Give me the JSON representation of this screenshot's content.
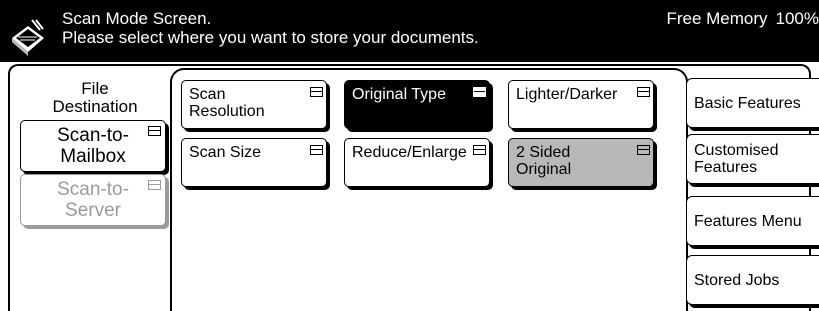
{
  "header": {
    "title": "Scan Mode Screen.",
    "subtitle": "Please select where you want to store your documents.",
    "memory_label": "Free Memory",
    "memory_value": "100%",
    "icon": "scanner-icon"
  },
  "destination": {
    "label_line1": "File",
    "label_line2": "Destination",
    "buttons": [
      {
        "line1": "Scan-to-",
        "line2": "Mailbox",
        "enabled": true
      },
      {
        "line1": "Scan-to-",
        "line2": "Server",
        "enabled": false
      }
    ]
  },
  "features": {
    "scan_resolution": {
      "line1": "Scan",
      "line2": "Resolution"
    },
    "original_type": "Original Type",
    "lighter_darker": "Lighter/Darker",
    "scan_size": "Scan Size",
    "reduce_enlarge": "Reduce/Enlarge",
    "two_sided": {
      "line1": "2 Sided",
      "line2": "Original"
    }
  },
  "side_tabs": {
    "basic": "Basic Features",
    "customised": {
      "line1": "Customised",
      "line2": "Features"
    },
    "menu": "Features Menu",
    "stored": "Stored Jobs"
  },
  "colors": {
    "header_bg": "#000000",
    "selected_bg": "#000000",
    "grey_bg": "#b8b8b8",
    "disabled_text": "#9a9a9a"
  }
}
